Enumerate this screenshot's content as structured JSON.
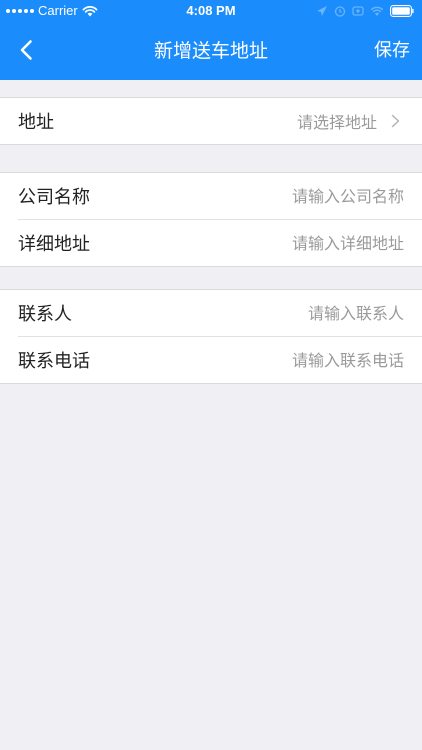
{
  "status": {
    "carrier": "Carrier",
    "time": "4:08 PM"
  },
  "nav": {
    "title": "新增送车地址",
    "save_label": "保存"
  },
  "address_section": {
    "label": "地址",
    "placeholder": "请选择地址"
  },
  "company_section": {
    "rows": [
      {
        "label": "公司名称",
        "placeholder": "请输入公司名称"
      },
      {
        "label": "详细地址",
        "placeholder": "请输入详细地址"
      }
    ]
  },
  "contact_section": {
    "rows": [
      {
        "label": "联系人",
        "placeholder": "请输入联系人"
      },
      {
        "label": "联系电话",
        "placeholder": "请输入联系电话"
      }
    ]
  },
  "colors": {
    "accent": "#1a8cfb",
    "background": "#efeff4",
    "placeholder": "#9a9a9a"
  }
}
